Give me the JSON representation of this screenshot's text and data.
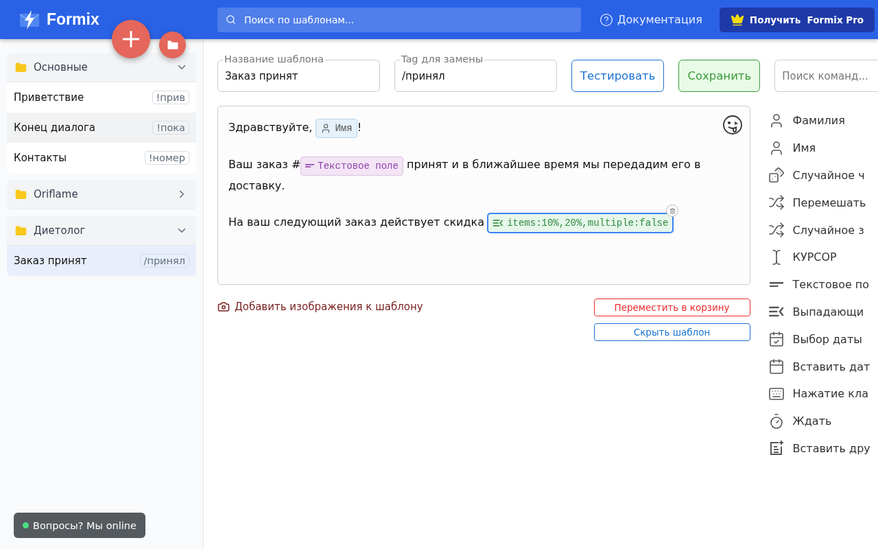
{
  "header": {
    "logo": "Formix",
    "search_placeholder": "Поиск по шаблонам...",
    "docs_link": "Документация",
    "pro_button": "Получить  Formix Pro"
  },
  "sidebar": {
    "folders": [
      {
        "name": "Основные",
        "expanded": true,
        "items": [
          {
            "title": "Приветствие",
            "tag": "!прив",
            "selected": false,
            "highlighted": false
          },
          {
            "title": "Конец диалога",
            "tag": "!пока",
            "selected": false,
            "highlighted": true
          },
          {
            "title": "Контакты",
            "tag": "!номер",
            "selected": false,
            "highlighted": false
          }
        ]
      },
      {
        "name": "Oriflame",
        "expanded": false
      },
      {
        "name": "Диетолог",
        "expanded": true,
        "items": [
          {
            "title": "Заказ принят",
            "tag": "/принял",
            "selected": true,
            "highlighted": false
          }
        ]
      }
    ],
    "chat_badge": {
      "label": "Вопросы? Мы online",
      "online": true
    }
  },
  "form": {
    "name_field": {
      "label": "Название шаблона",
      "value": "Заказ принят"
    },
    "tag_field": {
      "label": "Tag для замены",
      "value": "/принял"
    },
    "test_button": "Тестировать",
    "save_button": "Сохранить",
    "command_search_placeholder": "Поиск команд..."
  },
  "editor": {
    "lines": [
      [
        {
          "kind": "text",
          "text": "Здравствуйте, "
        },
        {
          "kind": "person",
          "text": "Имя",
          "selected": false
        },
        {
          "kind": "text",
          "text": "!"
        }
      ],
      [
        {
          "kind": "text",
          "text": "Ваш заказ #"
        },
        {
          "kind": "textfield",
          "text": "Текстовое поле",
          "selected": false
        },
        {
          "kind": "text",
          "text": " принят и в ближайшее время мы передадим его в"
        },
        {
          "kind": "text",
          "text": "доставку."
        }
      ],
      [
        {
          "kind": "text",
          "text": "На ваш следующий заказ действует скидка "
        },
        {
          "kind": "dropdown",
          "text": "items:10%,20%,multiple:false",
          "selected": true
        }
      ]
    ]
  },
  "actions": {
    "add_images": "Добавить изображения к шаблону",
    "trash_button": "Переместить в корзину",
    "hide_button": "Скрыть шаблон"
  },
  "commands": [
    {
      "kind": "person",
      "label": "Фамилия"
    },
    {
      "kind": "person",
      "label": "Имя"
    },
    {
      "kind": "dice",
      "label": "Случайное ч"
    },
    {
      "kind": "shuffle",
      "label": "Перемешать"
    },
    {
      "kind": "shuffle",
      "label": "Случайное з"
    },
    {
      "kind": "cursor",
      "label": "КУРСОР"
    },
    {
      "kind": "textfield",
      "label": "Текстовое по"
    },
    {
      "kind": "dropdown",
      "label": "Выпадающи"
    },
    {
      "kind": "datepick",
      "label": "Выбор даты"
    },
    {
      "kind": "date",
      "label": "Вставить дат"
    },
    {
      "kind": "keyboard",
      "label": "Нажатие кла"
    },
    {
      "kind": "timer",
      "label": "Ждать"
    },
    {
      "kind": "insert",
      "label": "Вставить дру"
    }
  ]
}
